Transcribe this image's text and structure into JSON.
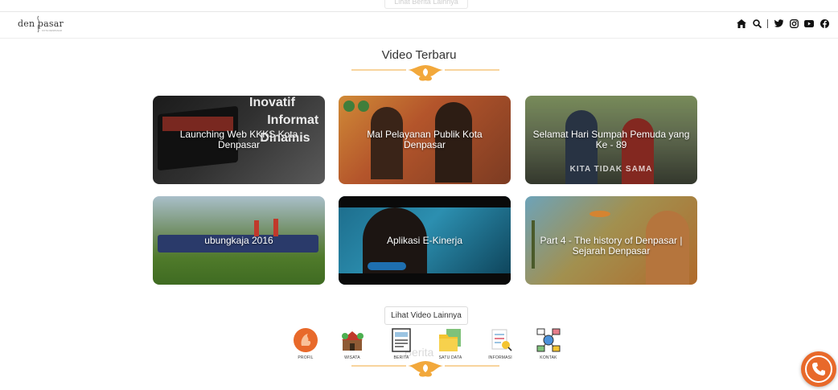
{
  "header": {
    "logo_text": "den    pasar",
    "logo_sub": "KOTA DENPASAR",
    "ghost_top_button": "Lihat Berita Lainnya",
    "icons": [
      "home-icon",
      "search-icon",
      "twitter-icon",
      "instagram-icon",
      "youtube-icon",
      "facebook-icon"
    ]
  },
  "videos": {
    "title": "Video Terbaru",
    "items": [
      {
        "caption": "Launching Web KKKS Kota Denpasar",
        "overlay": "Inovatif\n     Informat\n   Dinamis"
      },
      {
        "caption": "Mal Pelayanan Publik Kota Denpasar"
      },
      {
        "caption": "Selamat Hari Sumpah Pemuda yang Ke - 89",
        "overlay": "KITA TIDAK SAMA"
      },
      {
        "caption": "ubungkaja 2016"
      },
      {
        "caption": "Aplikasi E-Kinerja"
      },
      {
        "caption": "Part 4 - The history of Denpasar | Sejarah Denpasar"
      }
    ],
    "more_button": "Lihat Video Lainnya"
  },
  "next_section_title": "Berita",
  "dock": {
    "items": [
      {
        "label": "PROFIL",
        "icon": "profile-icon"
      },
      {
        "label": "WISATA",
        "icon": "tourism-icon"
      },
      {
        "label": "BERITA",
        "icon": "news-icon"
      },
      {
        "label": "SATU DATA",
        "icon": "data-folder-icon"
      },
      {
        "label": "INFORMASI",
        "icon": "information-icon"
      },
      {
        "label": "KONTAK",
        "icon": "contact-icon"
      }
    ]
  },
  "colors": {
    "accent": "#e8692a",
    "ornament": "#f2a83b"
  }
}
